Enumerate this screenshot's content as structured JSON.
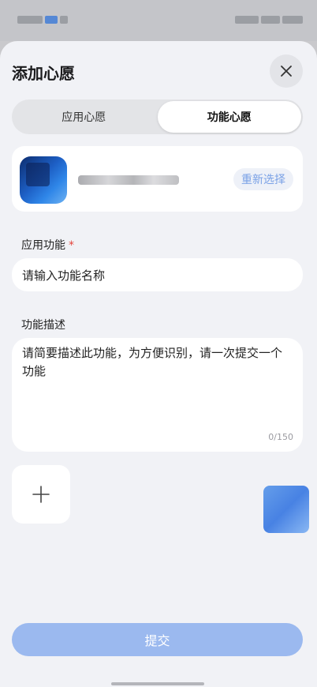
{
  "header": {
    "title": "添加心愿"
  },
  "tabs": [
    {
      "label": "应用心愿",
      "active": false
    },
    {
      "label": "功能心愿",
      "active": true
    }
  ],
  "app_card": {
    "reselect_label": "重新选择"
  },
  "feature_name": {
    "label": "应用功能",
    "required_mark": "*",
    "placeholder": "请输入功能名称"
  },
  "feature_desc": {
    "label": "功能描述",
    "placeholder": "请简要描述此功能，为方便识别，请一次提交一个功能",
    "counter": "0/150"
  },
  "upload": {
    "icon": "plus-icon"
  },
  "submit": {
    "label": "提交"
  },
  "colors": {
    "accent": "#9bb9ef",
    "accent_text": "#7aa1e6",
    "required": "#e5453d",
    "background": "#f1f2f6"
  }
}
